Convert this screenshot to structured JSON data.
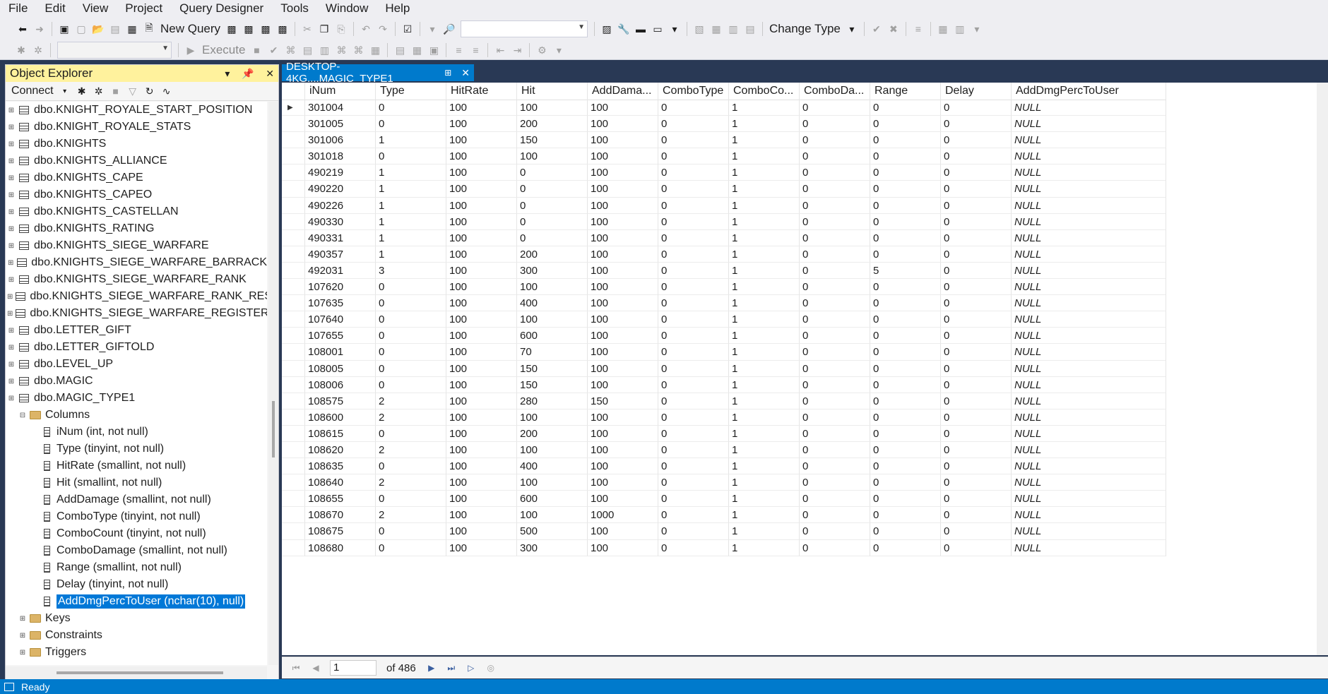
{
  "menu": [
    "File",
    "Edit",
    "View",
    "Project",
    "Query Designer",
    "Tools",
    "Window",
    "Help"
  ],
  "toolbar": {
    "new_query": "New Query",
    "change_type": "Change Type",
    "execute": "Execute"
  },
  "object_explorer": {
    "title": "Object Explorer",
    "connect": "Connect",
    "tables": [
      "dbo.KNIGHT_ROYALE_START_POSITION",
      "dbo.KNIGHT_ROYALE_STATS",
      "dbo.KNIGHTS",
      "dbo.KNIGHTS_ALLIANCE",
      "dbo.KNIGHTS_CAPE",
      "dbo.KNIGHTS_CAPEO",
      "dbo.KNIGHTS_CASTELLAN",
      "dbo.KNIGHTS_RATING",
      "dbo.KNIGHTS_SIEGE_WARFARE",
      "dbo.KNIGHTS_SIEGE_WARFARE_BARRACK",
      "dbo.KNIGHTS_SIEGE_WARFARE_RANK",
      "dbo.KNIGHTS_SIEGE_WARFARE_RANK_RESULT",
      "dbo.KNIGHTS_SIEGE_WARFARE_REGISTER",
      "dbo.LETTER_GIFT",
      "dbo.LETTER_GIFTOLD",
      "dbo.LEVEL_UP",
      "dbo.MAGIC",
      "dbo.MAGIC_TYPE1"
    ],
    "columns_folder": "Columns",
    "columns": [
      "iNum (int, not null)",
      "Type (tinyint, not null)",
      "HitRate (smallint, not null)",
      "Hit (smallint, not null)",
      "AddDamage (smallint, not null)",
      "ComboType (tinyint, not null)",
      "ComboCount (tinyint, not null)",
      "ComboDamage (smallint, not null)",
      "Range (smallint, not null)",
      "Delay (tinyint, not null)",
      "AddDmgPercToUser (nchar(10), null)"
    ],
    "folders": [
      "Keys",
      "Constraints",
      "Triggers"
    ]
  },
  "document_tab": {
    "title": "DESKTOP-4KG....MAGIC_TYPE1"
  },
  "grid": {
    "headers": [
      "iNum",
      "Type",
      "HitRate",
      "Hit",
      "AddDama...",
      "ComboType",
      "ComboCo...",
      "ComboDa...",
      "Range",
      "Delay",
      "AddDmgPercToUser"
    ],
    "rows": [
      [
        "301004",
        "0",
        "100",
        "100",
        "100",
        "0",
        "1",
        "0",
        "0",
        "0",
        "NULL"
      ],
      [
        "301005",
        "0",
        "100",
        "200",
        "100",
        "0",
        "1",
        "0",
        "0",
        "0",
        "NULL"
      ],
      [
        "301006",
        "1",
        "100",
        "150",
        "100",
        "0",
        "1",
        "0",
        "0",
        "0",
        "NULL"
      ],
      [
        "301018",
        "0",
        "100",
        "100",
        "100",
        "0",
        "1",
        "0",
        "0",
        "0",
        "NULL"
      ],
      [
        "490219",
        "1",
        "100",
        "0",
        "100",
        "0",
        "1",
        "0",
        "0",
        "0",
        "NULL"
      ],
      [
        "490220",
        "1",
        "100",
        "0",
        "100",
        "0",
        "1",
        "0",
        "0",
        "0",
        "NULL"
      ],
      [
        "490226",
        "1",
        "100",
        "0",
        "100",
        "0",
        "1",
        "0",
        "0",
        "0",
        "NULL"
      ],
      [
        "490330",
        "1",
        "100",
        "0",
        "100",
        "0",
        "1",
        "0",
        "0",
        "0",
        "NULL"
      ],
      [
        "490331",
        "1",
        "100",
        "0",
        "100",
        "0",
        "1",
        "0",
        "0",
        "0",
        "NULL"
      ],
      [
        "490357",
        "1",
        "100",
        "200",
        "100",
        "0",
        "1",
        "0",
        "0",
        "0",
        "NULL"
      ],
      [
        "492031",
        "3",
        "100",
        "300",
        "100",
        "0",
        "1",
        "0",
        "5",
        "0",
        "NULL"
      ],
      [
        "107620",
        "0",
        "100",
        "100",
        "100",
        "0",
        "1",
        "0",
        "0",
        "0",
        "NULL"
      ],
      [
        "107635",
        "0",
        "100",
        "400",
        "100",
        "0",
        "1",
        "0",
        "0",
        "0",
        "NULL"
      ],
      [
        "107640",
        "0",
        "100",
        "100",
        "100",
        "0",
        "1",
        "0",
        "0",
        "0",
        "NULL"
      ],
      [
        "107655",
        "0",
        "100",
        "600",
        "100",
        "0",
        "1",
        "0",
        "0",
        "0",
        "NULL"
      ],
      [
        "108001",
        "0",
        "100",
        "70",
        "100",
        "0",
        "1",
        "0",
        "0",
        "0",
        "NULL"
      ],
      [
        "108005",
        "0",
        "100",
        "150",
        "100",
        "0",
        "1",
        "0",
        "0",
        "0",
        "NULL"
      ],
      [
        "108006",
        "0",
        "100",
        "150",
        "100",
        "0",
        "1",
        "0",
        "0",
        "0",
        "NULL"
      ],
      [
        "108575",
        "2",
        "100",
        "280",
        "150",
        "0",
        "1",
        "0",
        "0",
        "0",
        "NULL"
      ],
      [
        "108600",
        "2",
        "100",
        "100",
        "100",
        "0",
        "1",
        "0",
        "0",
        "0",
        "NULL"
      ],
      [
        "108615",
        "0",
        "100",
        "200",
        "100",
        "0",
        "1",
        "0",
        "0",
        "0",
        "NULL"
      ],
      [
        "108620",
        "2",
        "100",
        "100",
        "100",
        "0",
        "1",
        "0",
        "0",
        "0",
        "NULL"
      ],
      [
        "108635",
        "0",
        "100",
        "400",
        "100",
        "0",
        "1",
        "0",
        "0",
        "0",
        "NULL"
      ],
      [
        "108640",
        "2",
        "100",
        "100",
        "100",
        "0",
        "1",
        "0",
        "0",
        "0",
        "NULL"
      ],
      [
        "108655",
        "0",
        "100",
        "600",
        "100",
        "0",
        "1",
        "0",
        "0",
        "0",
        "NULL"
      ],
      [
        "108670",
        "2",
        "100",
        "100",
        "1000",
        "0",
        "1",
        "0",
        "0",
        "0",
        "NULL"
      ],
      [
        "108675",
        "0",
        "100",
        "500",
        "100",
        "0",
        "1",
        "0",
        "0",
        "0",
        "NULL"
      ],
      [
        "108680",
        "0",
        "100",
        "300",
        "100",
        "0",
        "1",
        "0",
        "0",
        "0",
        "NULL"
      ]
    ]
  },
  "navigator": {
    "current": "1",
    "of_total": "of 486"
  },
  "status": {
    "text": "Ready"
  },
  "colors": {
    "accent": "#007acc",
    "oe_title": "#fff29d",
    "selection": "#0078d7"
  }
}
